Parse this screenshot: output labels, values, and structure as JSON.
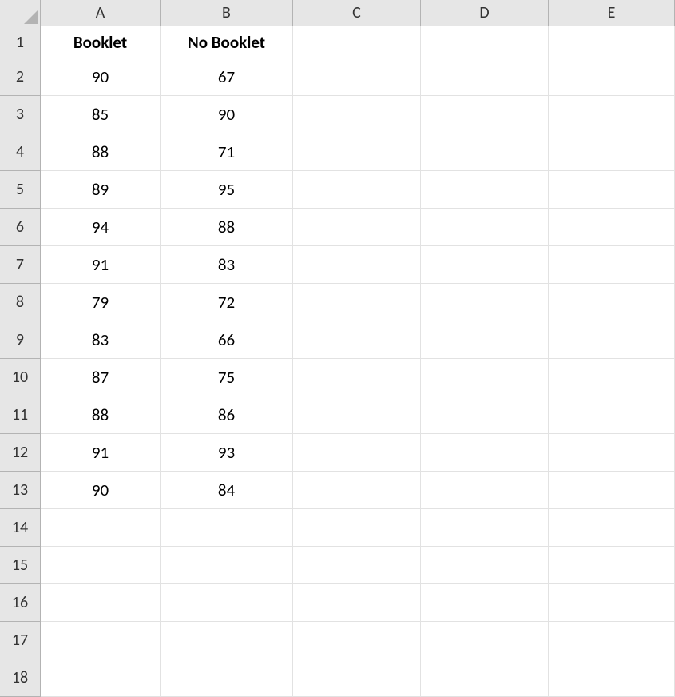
{
  "columns": [
    "A",
    "B",
    "C",
    "D",
    "E"
  ],
  "rowNumbers": [
    1,
    2,
    3,
    4,
    5,
    6,
    7,
    8,
    9,
    10,
    11,
    12,
    13,
    14,
    15,
    16,
    17,
    18
  ],
  "headers": {
    "A": "Booklet",
    "B": "No Booklet"
  },
  "chart_data": {
    "type": "table",
    "title": "",
    "columns": [
      "Booklet",
      "No Booklet"
    ],
    "rows": [
      [
        90,
        67
      ],
      [
        85,
        90
      ],
      [
        88,
        71
      ],
      [
        89,
        95
      ],
      [
        94,
        88
      ],
      [
        91,
        83
      ],
      [
        79,
        72
      ],
      [
        83,
        66
      ],
      [
        87,
        75
      ],
      [
        88,
        86
      ],
      [
        91,
        93
      ],
      [
        90,
        84
      ]
    ]
  },
  "cells": {
    "r2": {
      "A": "90",
      "B": "67"
    },
    "r3": {
      "A": "85",
      "B": "90"
    },
    "r4": {
      "A": "88",
      "B": "71"
    },
    "r5": {
      "A": "89",
      "B": "95"
    },
    "r6": {
      "A": "94",
      "B": "88"
    },
    "r7": {
      "A": "91",
      "B": "83"
    },
    "r8": {
      "A": "79",
      "B": "72"
    },
    "r9": {
      "A": "83",
      "B": "66"
    },
    "r10": {
      "A": "87",
      "B": "75"
    },
    "r11": {
      "A": "88",
      "B": "86"
    },
    "r12": {
      "A": "91",
      "B": "93"
    },
    "r13": {
      "A": "90",
      "B": "84"
    }
  }
}
